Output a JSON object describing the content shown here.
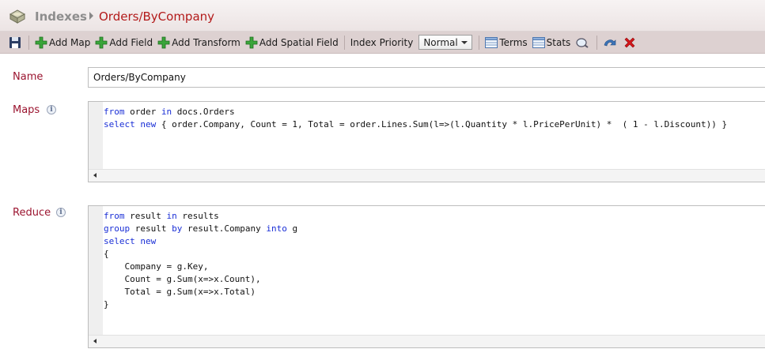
{
  "header": {
    "root_label": "Indexes",
    "current_label": "Orders/ByCompany",
    "db_icon": "database-icon"
  },
  "toolbar": {
    "save_icon": "save-icon",
    "add_map_label": "Add Map",
    "add_field_label": "Add Field",
    "add_transform_label": "Add Transform",
    "add_spatial_field_label": "Add Spatial Field",
    "index_priority_label": "Index Priority",
    "priority_value": "Normal",
    "terms_label": "Terms",
    "stats_label": "Stats",
    "colors": {
      "add_green": "#3aa53a",
      "delete_red": "#d4161a"
    }
  },
  "name": {
    "label": "Name",
    "value": "Orders/ByCompany"
  },
  "maps": {
    "label": "Maps",
    "lines": [
      [
        {
          "t": "from",
          "k": true
        },
        {
          "t": " order "
        },
        {
          "t": "in",
          "k": true
        },
        {
          "t": " docs.Orders"
        }
      ],
      [
        {
          "t": "select",
          "k": true
        },
        {
          "t": " "
        },
        {
          "t": "new",
          "k": true
        },
        {
          "t": " { order.Company, Count = 1, Total = order.Lines.Sum(l=>(l.Quantity * l.PricePerUnit) *  ( 1 - l.Discount)) }"
        }
      ]
    ]
  },
  "reduce": {
    "label": "Reduce",
    "lines": [
      [
        {
          "t": "from",
          "k": true
        },
        {
          "t": " result "
        },
        {
          "t": "in",
          "k": true
        },
        {
          "t": " results"
        }
      ],
      [
        {
          "t": "group",
          "k": true
        },
        {
          "t": " result "
        },
        {
          "t": "by",
          "k": true
        },
        {
          "t": " result.Company "
        },
        {
          "t": "into",
          "k": true
        },
        {
          "t": " g"
        }
      ],
      [
        {
          "t": "select",
          "k": true
        },
        {
          "t": " "
        },
        {
          "t": "new",
          "k": true
        }
      ],
      [
        {
          "t": "{"
        }
      ],
      [
        {
          "t": "    Company = g.Key,"
        }
      ],
      [
        {
          "t": "    Count = g.Sum(x=>x.Count),"
        }
      ],
      [
        {
          "t": "    Total = g.Sum(x=>x.Total)"
        }
      ],
      [
        {
          "t": "}"
        }
      ]
    ]
  }
}
